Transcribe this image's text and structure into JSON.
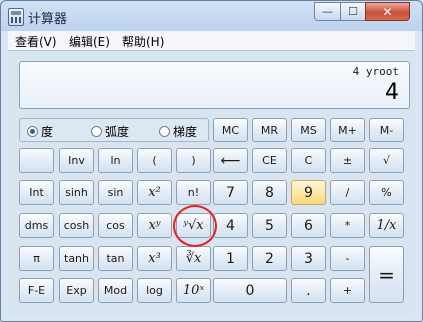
{
  "window": {
    "title": "计算器",
    "min_glyph": "—",
    "max_glyph": "☐",
    "close_glyph": "✕"
  },
  "menu": {
    "view": "查看(V)",
    "edit": "编辑(E)",
    "help": "帮助(H)"
  },
  "display": {
    "expression": "4 yroot",
    "value": "4"
  },
  "modes": {
    "deg": "度",
    "rad": "弧度",
    "grad": "梯度",
    "selected": "度"
  },
  "memory": {
    "mc": "MC",
    "mr": "MR",
    "ms": "MS",
    "mplus": "M+",
    "mminus": "M-"
  },
  "buttons": {
    "inv": "Inv",
    "ln": "ln",
    "lparen": "(",
    "rparen": ")",
    "back": "⟵",
    "ce": "CE",
    "c": "C",
    "plusminus": "±",
    "sqrt": "√",
    "int": "Int",
    "sinh": "sinh",
    "sin": "sin",
    "x2": "x²",
    "fact": "n!",
    "n7": "7",
    "n8": "8",
    "n9": "9",
    "div": "/",
    "pct": "%",
    "dms": "dms",
    "cosh": "cosh",
    "cos": "cos",
    "xy": "xʸ",
    "yroot": "ʸ√x",
    "n4": "4",
    "n5": "5",
    "n6": "6",
    "mul": "*",
    "recip": "1/x",
    "pi": "π",
    "tanh": "tanh",
    "tan": "tan",
    "x3": "x³",
    "cbrt": "∛x",
    "n1": "1",
    "n2": "2",
    "n3": "3",
    "sub": "-",
    "eq": "=",
    "fe": "F-E",
    "exp": "Exp",
    "mod": "Mod",
    "log": "log",
    "tenx": "10ˣ",
    "n0": "0",
    "dot": ".",
    "add": "+"
  },
  "highlighted_key": "9",
  "annotation_color": "#e02424"
}
